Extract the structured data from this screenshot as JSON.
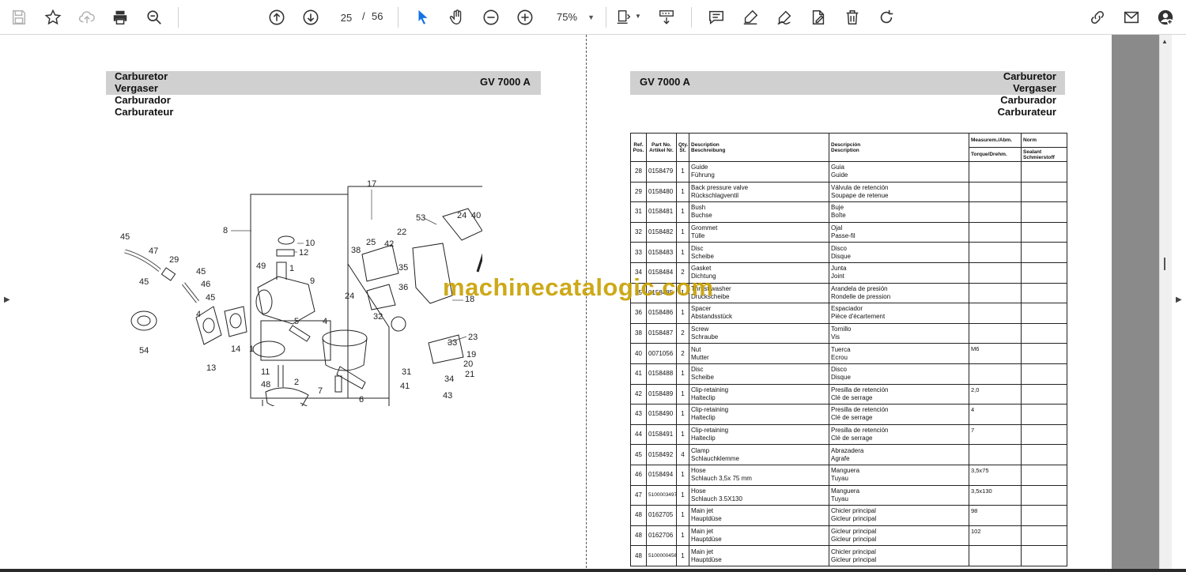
{
  "toolbar": {
    "page_current": "25",
    "page_separator": "/",
    "page_total": "56",
    "zoom": "75%"
  },
  "left_page": {
    "titles": [
      "Carburetor",
      "Vergaser",
      "Carburador",
      "Carburateur"
    ],
    "model": "GV 7000 A",
    "callouts": [
      "17",
      "8",
      "10",
      "12",
      "49",
      "1",
      "9",
      "45",
      "47",
      "29",
      "45",
      "46",
      "45",
      "4",
      "54",
      "13",
      "14",
      "5",
      "4",
      "1",
      "11",
      "48",
      "2",
      "7",
      "6",
      "3",
      "53",
      "24",
      "40",
      "27",
      "26",
      "22",
      "25",
      "42",
      "38",
      "35",
      "36",
      "28",
      "24",
      "18",
      "32",
      "23",
      "33",
      "19",
      "20",
      "31",
      "34",
      "21",
      "41",
      "43"
    ]
  },
  "right_page": {
    "model": "GV 7000 A",
    "titles": [
      "Carburetor",
      "Vergaser",
      "Carburador",
      "Carburateur"
    ],
    "table": {
      "headers": {
        "ref": [
          "Ref.",
          "Pos."
        ],
        "part_no": [
          "Part No.",
          "Artikel Nr."
        ],
        "qty": [
          "Qty.",
          "St."
        ],
        "desc": [
          "Description",
          "Beschreibung"
        ],
        "desc_es": [
          "Descripción",
          "Description"
        ],
        "measurem": "Measurem./Abm.",
        "torque": "Torque/Drehm.",
        "norm": "Norm",
        "sealant": [
          "Sealant",
          "Schmierstoff"
        ]
      },
      "rows": [
        {
          "ref": "28",
          "part": "0158479",
          "qty": "1",
          "d1": "Guide",
          "d2": "Führung",
          "e1": "Guia",
          "e2": "Guide",
          "meas": ""
        },
        {
          "ref": "29",
          "part": "0158480",
          "qty": "1",
          "d1": "Back pressure valve",
          "d2": "Rückschlagventil",
          "e1": "Válvula de retención",
          "e2": "Soupape de retenue",
          "meas": ""
        },
        {
          "ref": "31",
          "part": "0158481",
          "qty": "1",
          "d1": "Bush",
          "d2": "Buchse",
          "e1": "Buje",
          "e2": "Boîte",
          "meas": ""
        },
        {
          "ref": "32",
          "part": "0158482",
          "qty": "1",
          "d1": "Grommet",
          "d2": "Tülle",
          "e1": "Ojal",
          "e2": "Passe-fil",
          "meas": ""
        },
        {
          "ref": "33",
          "part": "0158483",
          "qty": "1",
          "d1": "Disc",
          "d2": "Scheibe",
          "e1": "Disco",
          "e2": "Disque",
          "meas": ""
        },
        {
          "ref": "34",
          "part": "0158484",
          "qty": "2",
          "d1": "Gasket",
          "d2": "Dichtung",
          "e1": "Junta",
          "e2": "Joint",
          "meas": ""
        },
        {
          "ref": "35",
          "part": "0158485",
          "qty": "1",
          "d1": "Thrust washer",
          "d2": "Druckscheibe",
          "e1": "Arandela de presión",
          "e2": "Rondelle de pression",
          "meas": ""
        },
        {
          "ref": "36",
          "part": "0158486",
          "qty": "1",
          "d1": "Spacer",
          "d2": "Abstandsstück",
          "e1": "Espaciador",
          "e2": "Pièce d'écartement",
          "meas": ""
        },
        {
          "ref": "38",
          "part": "0158487",
          "qty": "2",
          "d1": "Screw",
          "d2": "Schraube",
          "e1": "Tornillo",
          "e2": "Vis",
          "meas": ""
        },
        {
          "ref": "40",
          "part": "0071056",
          "qty": "2",
          "d1": "Nut",
          "d2": "Mutter",
          "e1": "Tuerca",
          "e2": "Ecrou",
          "meas": "M6"
        },
        {
          "ref": "41",
          "part": "0158488",
          "qty": "1",
          "d1": "Disc",
          "d2": "Scheibe",
          "e1": "Disco",
          "e2": "Disque",
          "meas": ""
        },
        {
          "ref": "42",
          "part": "0158489",
          "qty": "1",
          "d1": "Clip-retaining",
          "d2": "Halteclip",
          "e1": "Presilla de retención",
          "e2": "Clé de serrage",
          "meas": "2,0"
        },
        {
          "ref": "43",
          "part": "0158490",
          "qty": "1",
          "d1": "Clip-retaining",
          "d2": "Halteclip",
          "e1": "Presilla de retención",
          "e2": "Clé de serrage",
          "meas": "4"
        },
        {
          "ref": "44",
          "part": "0158491",
          "qty": "1",
          "d1": "Clip-retaining",
          "d2": "Halteclip",
          "e1": "Presilla de retención",
          "e2": "Clé de serrage",
          "meas": "7"
        },
        {
          "ref": "45",
          "part": "0158492",
          "qty": "4",
          "d1": "Clamp",
          "d2": "Schlauchklemme",
          "e1": "Abrazadera",
          "e2": "Agrafe",
          "meas": ""
        },
        {
          "ref": "46",
          "part": "0158494",
          "qty": "1",
          "d1": "Hose",
          "d2": "Schlauch 3,5x 75 mm",
          "e1": "Manguera",
          "e2": "Tuyau",
          "meas": "3,5x75"
        },
        {
          "ref": "47",
          "part": "5100003497",
          "qty": "1",
          "d1": "Hose",
          "d2": "Schlauch 3.5X130",
          "e1": "Manguera",
          "e2": "Tuyau",
          "meas": "3,5x130"
        },
        {
          "ref": "48",
          "part": "0162705",
          "qty": "1",
          "d1": "Main jet",
          "d2": "Hauptdüse",
          "e1": "Chicler principal",
          "e2": "Gicleur principal",
          "meas": "98"
        },
        {
          "ref": "48",
          "part": "0162706",
          "qty": "1",
          "d1": "Main jet",
          "d2": "Hauptdüse",
          "e1": "Gicleur principal",
          "e2": "Gicleur principal",
          "meas": "102"
        },
        {
          "ref": "48",
          "part": "5100000456",
          "qty": "1",
          "d1": "Main jet",
          "d2": "Hauptdüse",
          "e1": "Chicler principal",
          "e2": "Gicleur principal",
          "meas": ""
        }
      ]
    }
  },
  "watermark": "machinecatalogic.com"
}
